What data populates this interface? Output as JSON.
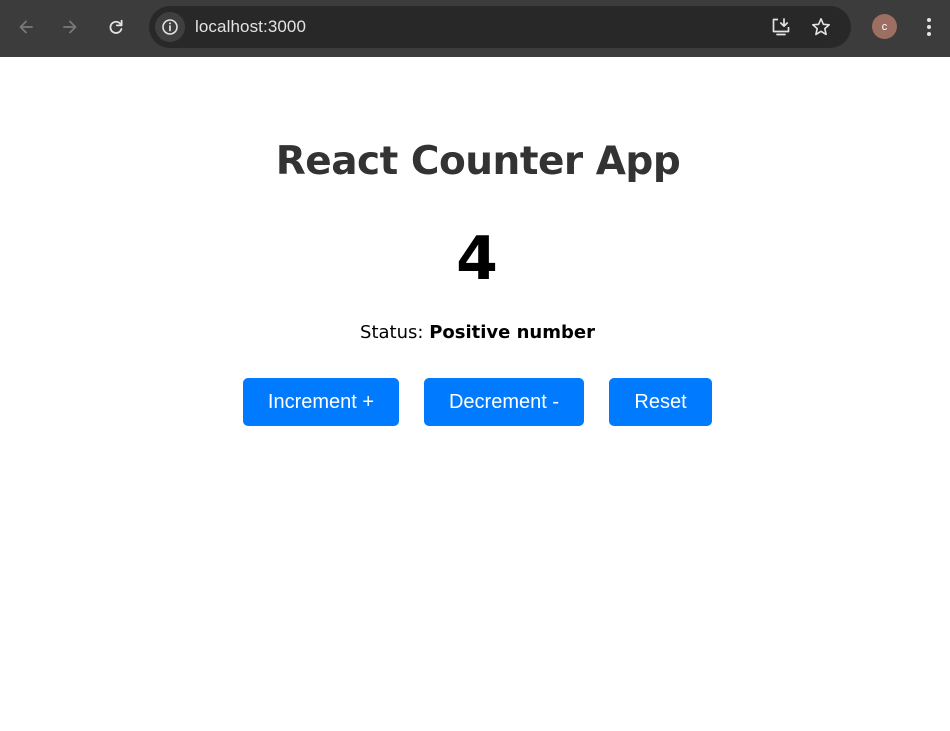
{
  "browser": {
    "url": "localhost:3000",
    "profile_initial": "c",
    "icons": {
      "back": "arrow-left-icon",
      "forward": "arrow-right-icon",
      "reload": "reload-icon",
      "site_info": "info-icon",
      "install": "install-app-icon",
      "bookmark": "star-icon",
      "menu": "kebab-menu-icon"
    }
  },
  "app": {
    "title": "React Counter App",
    "count": "4",
    "status_label": "Status: ",
    "status_value": "Positive number",
    "buttons": {
      "increment": "Increment +",
      "decrement": "Decrement -",
      "reset": "Reset"
    },
    "colors": {
      "button_bg": "#007bff",
      "button_text": "#ffffff",
      "title": "#333333"
    }
  }
}
